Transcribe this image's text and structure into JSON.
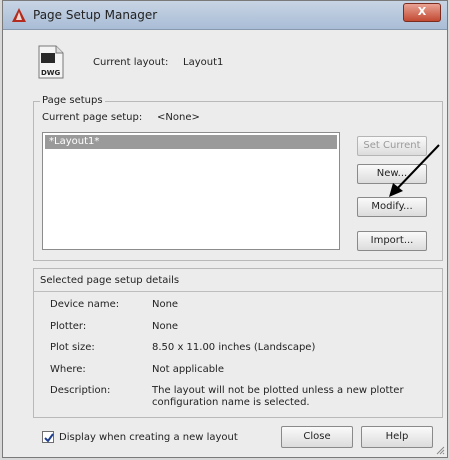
{
  "window": {
    "title": "Page Setup Manager",
    "close_label": "X"
  },
  "layout": {
    "current_label": "Current layout:",
    "current_value": "Layout1",
    "icon_text": "DWG"
  },
  "page_setups": {
    "group_title": "Page setups",
    "current_label": "Current page setup:",
    "current_value": "<None>",
    "items": [
      "*Layout1*"
    ],
    "selected_index": 0,
    "buttons": {
      "set_current": "Set Current",
      "new": "New...",
      "modify": "Modify...",
      "import": "Import..."
    }
  },
  "details": {
    "title": "Selected page setup details",
    "rows": [
      {
        "label": "Device name:",
        "value": "None"
      },
      {
        "label": "Plotter:",
        "value": "None"
      },
      {
        "label": "Plot size:",
        "value": "8.50 x 11.00 inches (Landscape)"
      },
      {
        "label": "Where:",
        "value": "Not applicable"
      },
      {
        "label": "Description:",
        "value": "The layout will not be plotted unless a new plotter configuration name is selected."
      }
    ]
  },
  "footer": {
    "checkbox_label": "Display when creating a new layout",
    "checkbox_checked": true,
    "close_label": "Close",
    "help_label": "Help"
  }
}
